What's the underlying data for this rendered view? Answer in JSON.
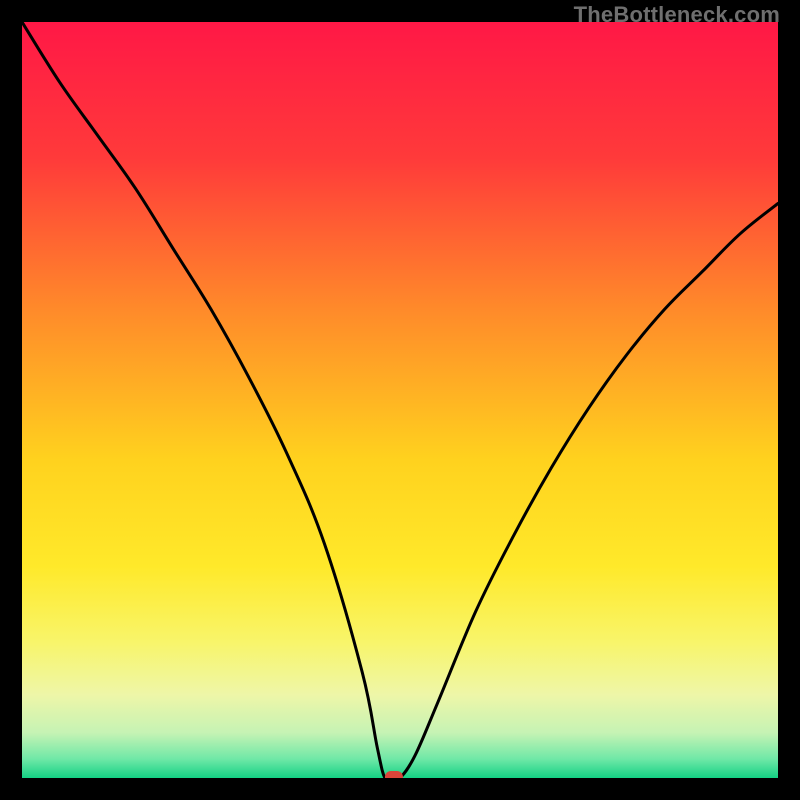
{
  "watermark": "TheBottleneck.com",
  "chart_data": {
    "type": "line",
    "title": "",
    "xlabel": "",
    "ylabel": "",
    "xlim": [
      0,
      100
    ],
    "ylim": [
      0,
      100
    ],
    "series": [
      {
        "name": "curve",
        "x": [
          0,
          5,
          10,
          15,
          20,
          25,
          30,
          35,
          40,
          45,
          47,
          48,
          49,
          50,
          52,
          55,
          60,
          65,
          70,
          75,
          80,
          85,
          90,
          95,
          100
        ],
        "y": [
          100,
          92,
          85,
          78,
          70,
          62,
          53,
          43,
          31,
          14,
          4,
          0,
          0,
          0,
          3,
          10,
          22,
          32,
          41,
          49,
          56,
          62,
          67,
          72,
          76
        ]
      }
    ],
    "marker": {
      "x": 49.2,
      "y": 0.0
    },
    "background": {
      "type": "vertical-gradient-with-green-base",
      "stops": [
        {
          "offset": 0.0,
          "color": "#ff1846"
        },
        {
          "offset": 0.18,
          "color": "#ff3a3a"
        },
        {
          "offset": 0.38,
          "color": "#ff8a2a"
        },
        {
          "offset": 0.58,
          "color": "#ffd21e"
        },
        {
          "offset": 0.72,
          "color": "#ffe92a"
        },
        {
          "offset": 0.82,
          "color": "#f8f56a"
        },
        {
          "offset": 0.89,
          "color": "#eef6a8"
        },
        {
          "offset": 0.94,
          "color": "#c6f3b4"
        },
        {
          "offset": 0.975,
          "color": "#6fe8a7"
        },
        {
          "offset": 1.0,
          "color": "#14d184"
        }
      ]
    }
  }
}
